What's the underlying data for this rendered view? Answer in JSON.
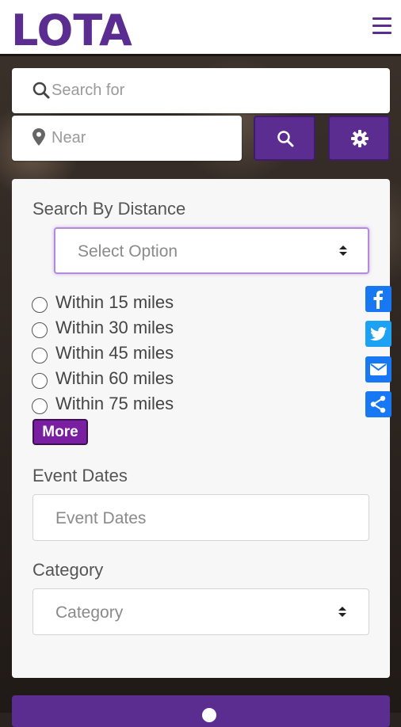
{
  "header": {
    "logo_text": "LOTA",
    "menu_icon": "hamburger-icon"
  },
  "search": {
    "search_for_placeholder": "Search for",
    "near_placeholder": "Near",
    "search_icon": "search-icon",
    "location_icon": "map-pin-icon",
    "search_button_icon": "search-icon",
    "settings_button_icon": "gear-icon"
  },
  "filters": {
    "distance_label": "Search By Distance",
    "distance_select_value": "Select Option",
    "distance_options": [
      "Within 15 miles",
      "Within 30 miles",
      "Within 45 miles",
      "Within 60 miles",
      "Within 75 miles"
    ],
    "more_label": "More",
    "event_dates_label": "Event Dates",
    "event_dates_placeholder": "Event Dates",
    "category_label": "Category",
    "category_value": "Category"
  },
  "share": [
    "facebook-icon",
    "twitter-icon",
    "email-icon",
    "share-icon"
  ],
  "colors": {
    "brand": "#5b2d91",
    "accent": "#7b1fa2",
    "social": "#1877f2",
    "twitter": "#1da1f2"
  }
}
